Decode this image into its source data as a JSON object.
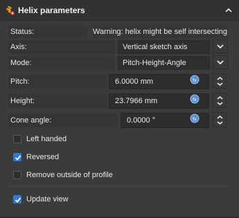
{
  "header": {
    "title": "Helix parameters",
    "icon": "helix-icon",
    "collapse_icon": "chevron-up-icon"
  },
  "status": {
    "label": "Status:",
    "value": "Warning: helix might be self intersecting"
  },
  "axis": {
    "label": "Axis:",
    "value": "Vertical sketch axis"
  },
  "mode": {
    "label": "Mode:",
    "value": "Pitch-Height-Angle"
  },
  "pitch": {
    "label": "Pitch:",
    "value": "6.0000 mm"
  },
  "height": {
    "label": "Height:",
    "value": "23.7966 mm"
  },
  "cone_angle": {
    "label": "Cone angle:",
    "value": "0.0000 °"
  },
  "options": {
    "left_handed": {
      "label": "Left handed",
      "checked": false
    },
    "reversed": {
      "label": "Reversed",
      "checked": true
    },
    "remove_outside": {
      "label": "Remove outside of profile",
      "checked": false
    },
    "update_view": {
      "label": "Update view",
      "checked": true
    }
  },
  "colors": {
    "background": "#3b3b3b",
    "accent": "#2f7ad8",
    "header": "#323232"
  }
}
